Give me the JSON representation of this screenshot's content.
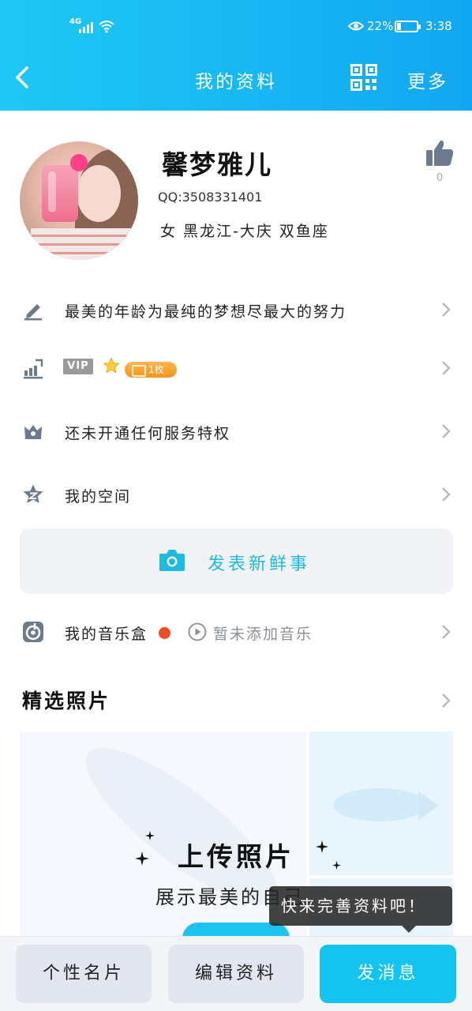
{
  "status_bar": {
    "network": "4G",
    "battery_text": "22%",
    "battery_level": 0.22,
    "time": "3:38"
  },
  "nav": {
    "title": "我的资料",
    "more_label": "更多",
    "back_icon": "back-arrow-icon",
    "qr_icon": "qr-code-icon"
  },
  "profile": {
    "nickname": "馨梦雅儿",
    "qq": "QQ:3508331401",
    "info": "女 黑龙江-大庆 双鱼座",
    "like_count": "0"
  },
  "rows": {
    "signature": "最美的年龄为最纯的梦想尽最大的努力",
    "vip_badge": "VIP",
    "vip_coin": "1枚",
    "privilege": "还未开通任何服务特权",
    "space": "我的空间"
  },
  "post": {
    "label": "发表新鲜事"
  },
  "music": {
    "label": "我的音乐盒",
    "status": "暂未添加音乐"
  },
  "photos": {
    "section_title": "精选照片",
    "upload_title": "上传照片",
    "upload_subtitle": "展示最美的自己"
  },
  "tooltip": {
    "text": "快来完善资料吧！"
  },
  "bottom_bar": {
    "card_label": "个性名片",
    "edit_label": "编辑资料",
    "message_label": "发消息"
  },
  "colors": {
    "header_start": "#1ec8f4",
    "header_end": "#11a6f2",
    "accent": "#1fbadf",
    "primary_button": "#14c4f0",
    "vip_coin": "#f5951c",
    "music_dot": "#f04d22",
    "icon_gray": "#6c7a8e"
  }
}
